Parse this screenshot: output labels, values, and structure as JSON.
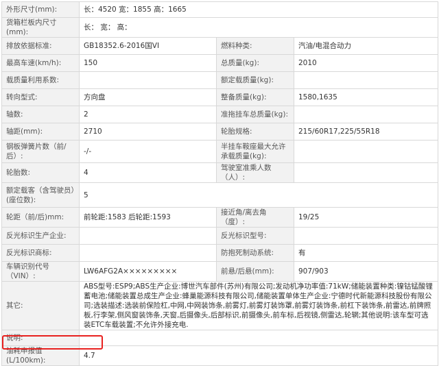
{
  "rows": [
    {
      "l1": "外形尺寸(mm):",
      "v1": "长：4520 宽：1855 高：1665"
    },
    {
      "l1": "货箱栏板内尺寸(mm):",
      "v1": "长： 宽： 高："
    },
    {
      "l1": "排放依据标准:",
      "v1": "GB18352.6-2016国VI",
      "l2": "燃料种类:",
      "v2": "汽油/电混合动力"
    },
    {
      "l1": "最高车速(km/h):",
      "v1": "150",
      "l2": "总质量(kg):",
      "v2": "2010"
    },
    {
      "l1": "载质量利用系数:",
      "v1": "",
      "l2": "额定载质量(kg):",
      "v2": ""
    },
    {
      "l1": "转向型式:",
      "v1": "方向盘",
      "l2": "整备质量(kg):",
      "v2": "1580,1635"
    },
    {
      "l1": "轴数:",
      "v1": "2",
      "l2": "准拖挂车总质量(kg):",
      "v2": ""
    },
    {
      "l1": "轴距(mm):",
      "v1": "2710",
      "l2": "轮胎规格:",
      "v2": "215/60R17,225/55R18"
    },
    {
      "l1": "钢板弹簧片数（前/后）:",
      "v1": "-/-",
      "l2": "半挂车鞍座最大允许承载质量(kg):",
      "v2": ""
    },
    {
      "l1": "轮胎数:",
      "v1": "4",
      "l2": "驾驶室准乘人数（人）:",
      "v2": ""
    },
    {
      "l1": "额定载客（含驾驶员）(座位数):",
      "v1": "5"
    },
    {
      "l1": "轮距（前/后)mm:",
      "v1": "前轮距:1583 后轮距:1593",
      "l2": "接近角/离去角（度）:",
      "v2": "19/25"
    },
    {
      "l1": "反光标识生产企业:",
      "v1": "",
      "l2": "反光标识型号:",
      "v2": ""
    },
    {
      "l1": "反光标识商标:",
      "v1": "",
      "l2": "防抱死制动系统:",
      "v2": "有"
    },
    {
      "l1": "车辆识别代号（VIN）:",
      "v1": "LW6AFG2A×××××××××",
      "l2": "前悬/后悬(mm):",
      "v2": "907/903"
    },
    {
      "l1": "其它:",
      "v1": "ABS型号:ESP9;ABS生产企业:博世汽车部件(苏州)有限公司;发动机净功率值:71kW;储能装置种类:镍钴锰酸锂蓄电池;储能装置总成生产企业:蜂巢能源科技有限公司,储能装置单体生产企业:宁德时代新能源科技股份有限公司;选装描述:选装前保险杠,中网,中网装饰条,前雾灯,前雾灯装饰罩,前雾灯装饰条,前杠下装饰条,前雷达,前牌照板,行李架,侧风窗装饰条,天窗,后摄像头,后部标识,前摄像头,前车标,后视镜,侧雷达,轮辋;其他说明:该车型可选装ETC车载装置;不允许外接充电."
    },
    {
      "l1": "说明:",
      "v1": ""
    },
    {
      "l1": "油耗申报值(L/100km):",
      "v1": "4.7"
    }
  ]
}
